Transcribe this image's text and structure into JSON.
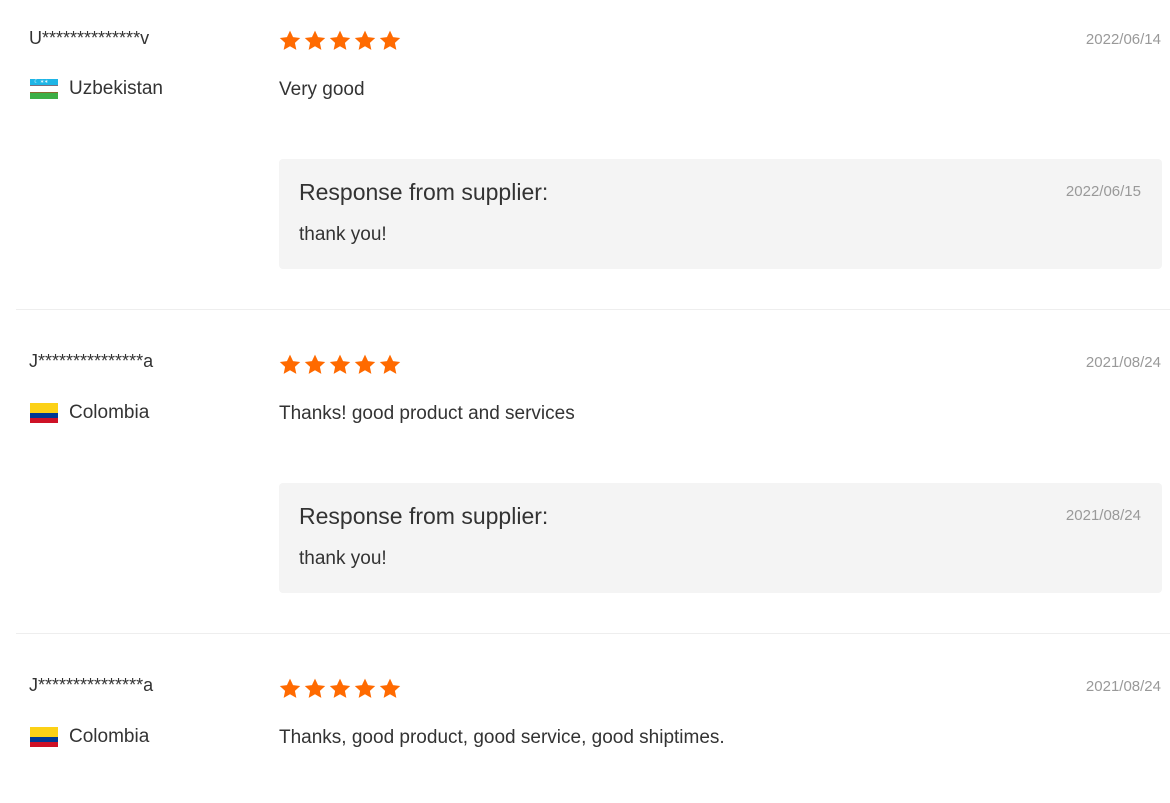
{
  "colors": {
    "star": "#ff6a00",
    "text": "#333333",
    "muted": "#999999",
    "response_bg": "#f4f4f4",
    "divider": "#eeeeee"
  },
  "reviews": [
    {
      "reviewer": "U**************v",
      "country": "Uzbekistan",
      "flag_icon": "uzbekistan-flag-icon",
      "rating": 5,
      "date": "2022/06/14",
      "text": "Very good",
      "response": {
        "title": "Response from supplier:",
        "date": "2022/06/15",
        "text": "thank you!"
      }
    },
    {
      "reviewer": "J***************a",
      "country": "Colombia",
      "flag_icon": "colombia-flag-icon",
      "rating": 5,
      "date": "2021/08/24",
      "text": "Thanks! good product and services",
      "response": {
        "title": "Response from supplier:",
        "date": "2021/08/24",
        "text": "thank you!"
      }
    },
    {
      "reviewer": "J***************a",
      "country": "Colombia",
      "flag_icon": "colombia-flag-icon",
      "rating": 5,
      "date": "2021/08/24",
      "text": "Thanks, good product, good service, good shiptimes."
    }
  ]
}
